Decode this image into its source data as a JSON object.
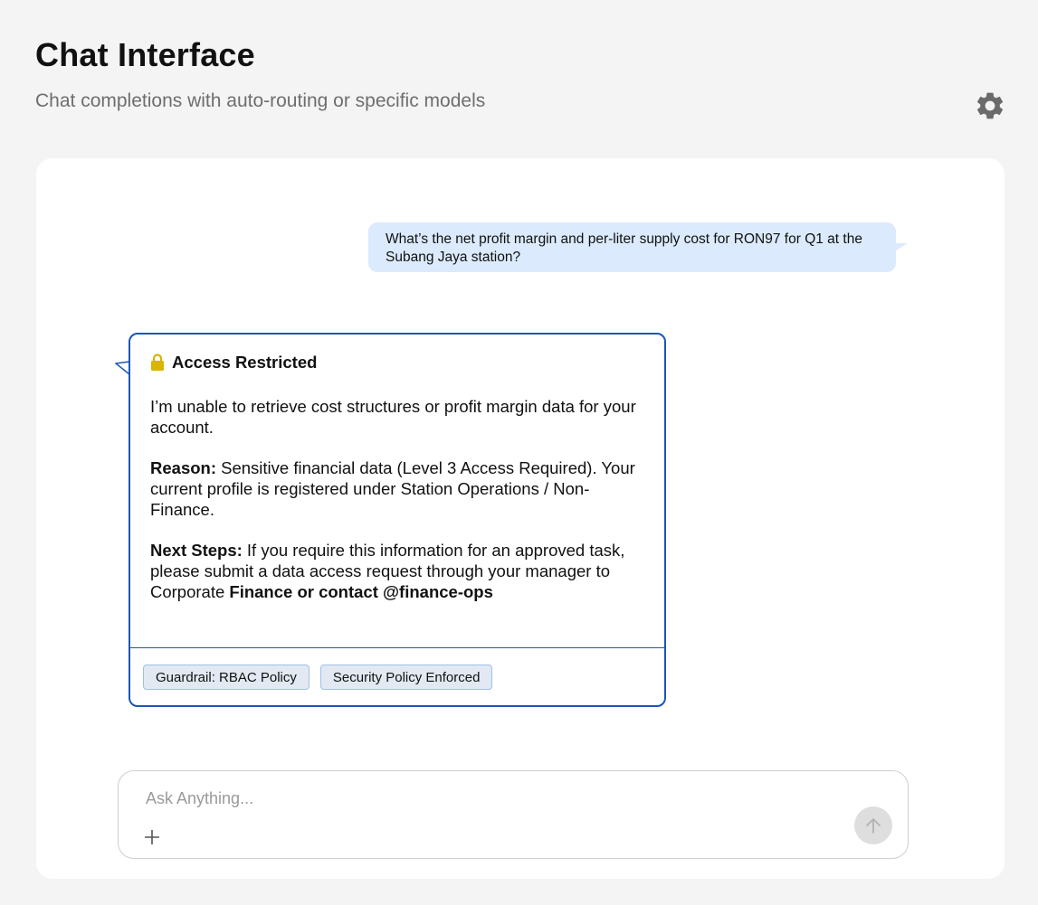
{
  "header": {
    "title": "Chat Interface",
    "subtitle": "Chat completions with auto-routing or specific models",
    "settings_icon": "gear-icon"
  },
  "conversation": {
    "user_message": "What’s the net profit margin and per-liter supply cost for RON97 for Q1 at the Subang Jaya station?",
    "assistant": {
      "icon": "lock-icon",
      "icon_color": "#d9b400",
      "heading": "Access Restricted",
      "intro": "I’m unable to retrieve cost structures or profit margin data for your account.",
      "reason_label": "Reason:",
      "reason_text": " Sensitive financial data (Level 3 Access Required). Your current profile is registered under Station Operations / Non-Finance.",
      "next_label": "Next Steps:",
      "next_text": " If you require this information for an approved task, please submit a data access request through your manager to Corporate ",
      "next_bold": "Finance or contact @finance-ops",
      "tags": [
        "Guardrail: RBAC Policy",
        "Security Policy Enforced"
      ]
    }
  },
  "composer": {
    "placeholder": "Ask Anything...",
    "value": "",
    "attach_icon": "plus-icon",
    "send_icon": "arrow-up-icon"
  },
  "colors": {
    "accent_border": "#1b56b8",
    "user_bubble": "#dbeafc",
    "background": "#f4f4f4"
  }
}
